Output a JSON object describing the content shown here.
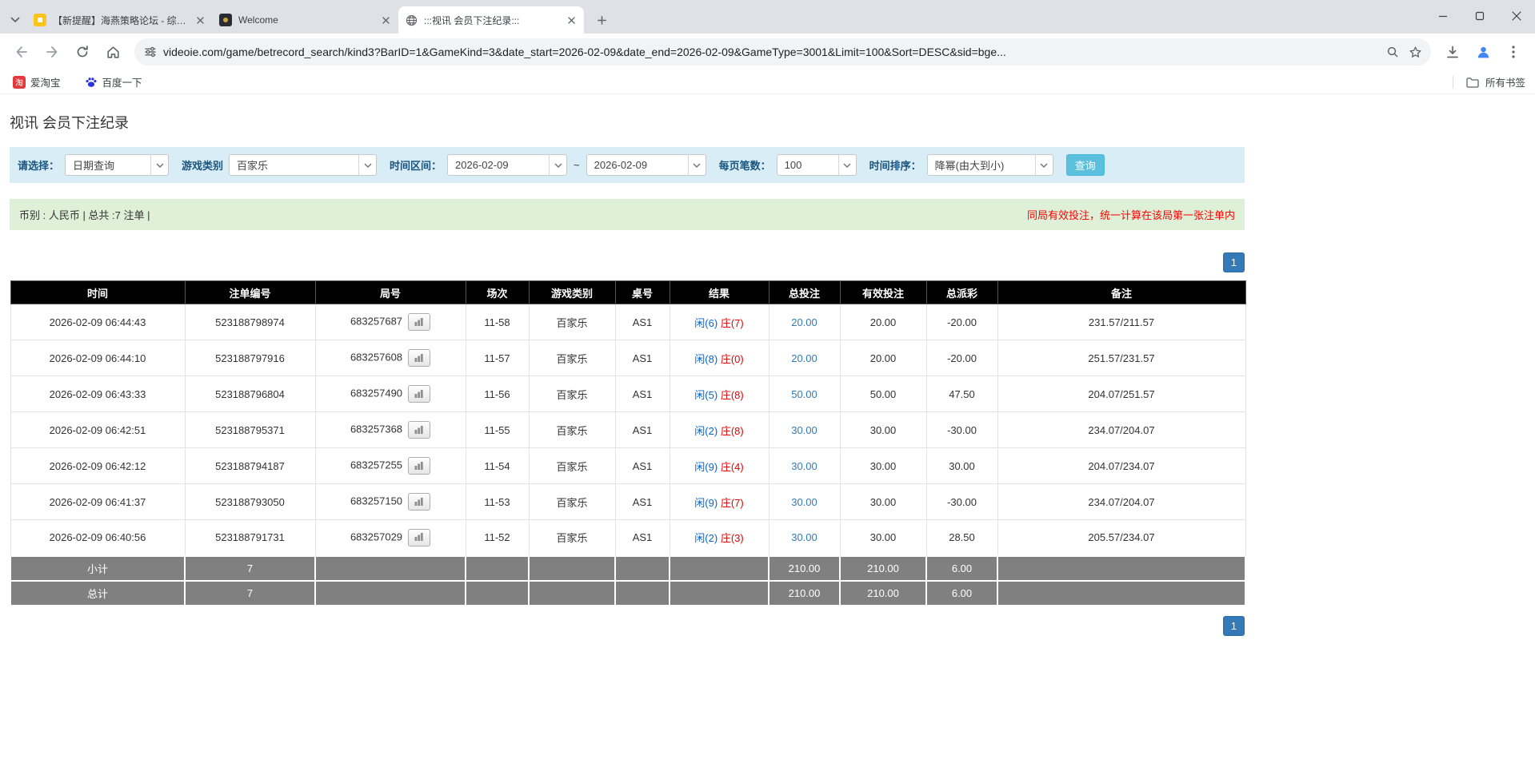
{
  "colors": {
    "pagination_blue": "#337ab7",
    "search_button_cyan": "#5bc0de",
    "filter_bar_bg": "#d9edf7",
    "summary_bar_bg": "#dff0d8",
    "notice_red": "#ff0000",
    "table_header_bg": "#000000",
    "table_footer_bg": "#808080",
    "total_bet_blue": "#337ab7",
    "player_blue": "#0066cc",
    "banker_red": "#e60000",
    "negative_red": "#e60000"
  },
  "browser": {
    "tabs": [
      {
        "title": "【新提醒】海燕策略论坛 - 综合...",
        "active": false
      },
      {
        "title": "Welcome",
        "active": false
      },
      {
        "title": ":::视讯 会员下注纪录:::",
        "active": true
      }
    ],
    "url": "videoie.com/game/betrecord_search/kind3?BarID=1&GameKind=3&date_start=2026-02-09&date_end=2026-02-09&GameType=3001&Limit=100&Sort=DESC&sid=bge...",
    "bookmarks": [
      {
        "label": "爱淘宝"
      },
      {
        "label": "百度一下"
      }
    ],
    "all_bookmarks_label": "所有书签"
  },
  "page": {
    "title": "视讯 会员下注纪录",
    "pagination": "1",
    "filters": {
      "select_label": "请选择：",
      "select_value": "日期查询",
      "game_type_label": "游戏类别",
      "game_type_value": "百家乐",
      "date_range_label": "时间区间：",
      "date_start": "2026-02-09",
      "date_separator": "~",
      "date_end": "2026-02-09",
      "per_page_label": "每页笔数：",
      "per_page_value": "100",
      "sort_label": "时间排序：",
      "sort_value": "降幂(由大到小)",
      "search_button": "查询"
    },
    "summary": {
      "left": "币别 : 人民币 | 总共 :7 注单 |",
      "right": "同局有效投注，统一计算在该局第一张注单内"
    },
    "table": {
      "headers": [
        "时间",
        "注单编号",
        "局号",
        "场次",
        "游戏类别",
        "桌号",
        "结果",
        "总投注",
        "有效投注",
        "总派彩",
        "备注"
      ],
      "rows": [
        {
          "time": "2026-02-09 06:44:43",
          "bet_id": "523188798974",
          "round": "683257687",
          "session": "11-58",
          "game": "百家乐",
          "table_no": "AS1",
          "result_player": "闲(6)",
          "result_banker": "庄(7)",
          "total_bet": "20.00",
          "valid_bet": "20.00",
          "payout": "-20.00",
          "note": "231.57/211.57"
        },
        {
          "time": "2026-02-09 06:44:10",
          "bet_id": "523188797916",
          "round": "683257608",
          "session": "11-57",
          "game": "百家乐",
          "table_no": "AS1",
          "result_player": "闲(8)",
          "result_banker": "庄(0)",
          "total_bet": "20.00",
          "valid_bet": "20.00",
          "payout": "-20.00",
          "note": "251.57/231.57"
        },
        {
          "time": "2026-02-09 06:43:33",
          "bet_id": "523188796804",
          "round": "683257490",
          "session": "11-56",
          "game": "百家乐",
          "table_no": "AS1",
          "result_player": "闲(5)",
          "result_banker": "庄(8)",
          "total_bet": "50.00",
          "valid_bet": "50.00",
          "payout": "47.50",
          "note": "204.07/251.57"
        },
        {
          "time": "2026-02-09 06:42:51",
          "bet_id": "523188795371",
          "round": "683257368",
          "session": "11-55",
          "game": "百家乐",
          "table_no": "AS1",
          "result_player": "闲(2)",
          "result_banker": "庄(8)",
          "total_bet": "30.00",
          "valid_bet": "30.00",
          "payout": "-30.00",
          "note": "234.07/204.07"
        },
        {
          "time": "2026-02-09 06:42:12",
          "bet_id": "523188794187",
          "round": "683257255",
          "session": "11-54",
          "game": "百家乐",
          "table_no": "AS1",
          "result_player": "闲(9)",
          "result_banker": "庄(4)",
          "total_bet": "30.00",
          "valid_bet": "30.00",
          "payout": "30.00",
          "note": "204.07/234.07"
        },
        {
          "time": "2026-02-09 06:41:37",
          "bet_id": "523188793050",
          "round": "683257150",
          "session": "11-53",
          "game": "百家乐",
          "table_no": "AS1",
          "result_player": "闲(9)",
          "result_banker": "庄(7)",
          "total_bet": "30.00",
          "valid_bet": "30.00",
          "payout": "-30.00",
          "note": "234.07/204.07"
        },
        {
          "time": "2026-02-09 06:40:56",
          "bet_id": "523188791731",
          "round": "683257029",
          "session": "11-52",
          "game": "百家乐",
          "table_no": "AS1",
          "result_player": "闲(2)",
          "result_banker": "庄(3)",
          "total_bet": "30.00",
          "valid_bet": "30.00",
          "payout": "28.50",
          "note": "205.57/234.07"
        }
      ],
      "subtotal": {
        "label": "小计",
        "count": "7",
        "total_bet": "210.00",
        "valid_bet": "210.00",
        "payout": "6.00"
      },
      "total": {
        "label": "总计",
        "count": "7",
        "total_bet": "210.00",
        "valid_bet": "210.00",
        "payout": "6.00"
      }
    }
  }
}
